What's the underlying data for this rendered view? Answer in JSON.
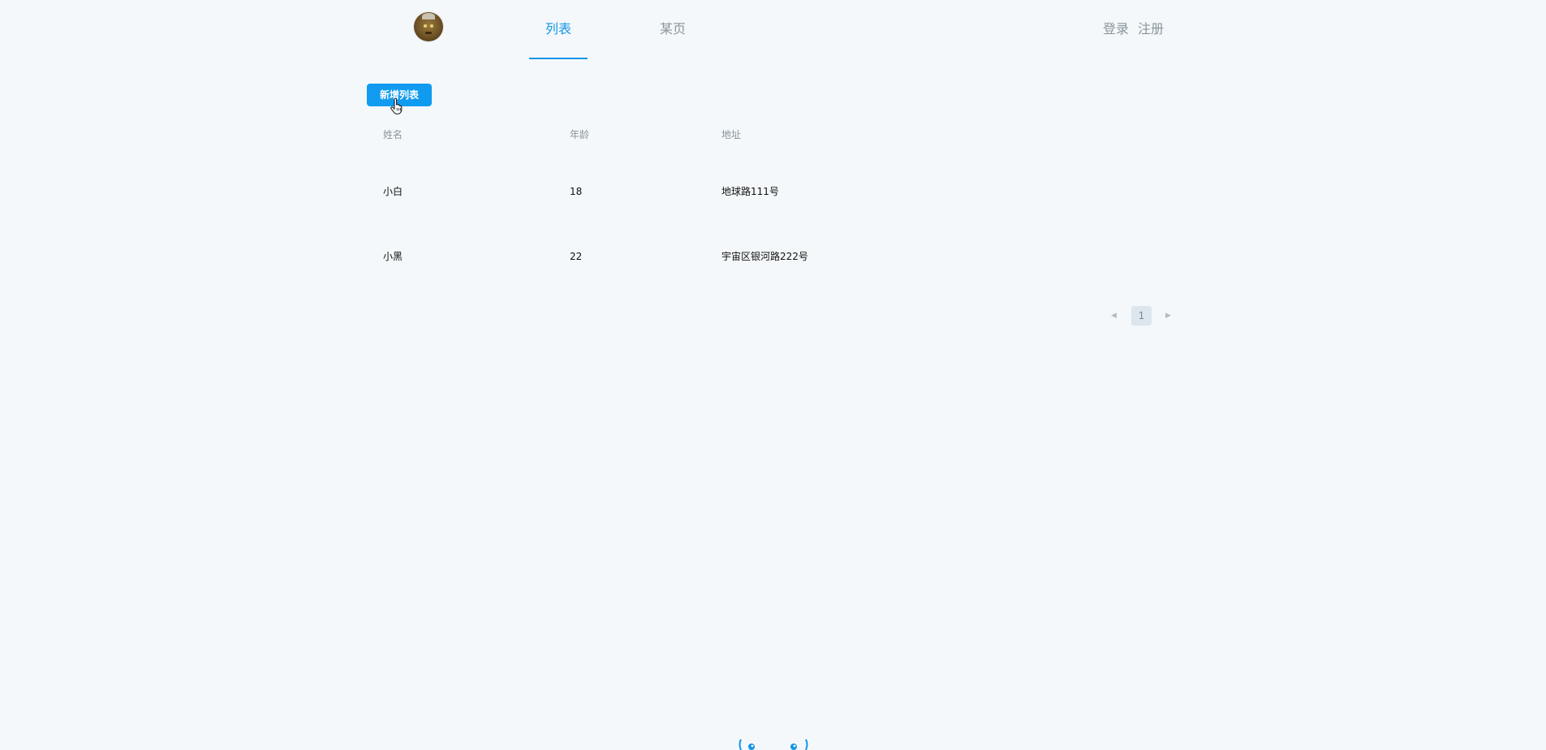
{
  "header": {
    "avatar_icon": "avatar-icon",
    "tabs": [
      {
        "label": "列表",
        "active": true
      },
      {
        "label": "某页",
        "active": false
      }
    ],
    "auth": {
      "login_label": "登录",
      "register_label": "注册"
    },
    "accent_color": "#1495e8"
  },
  "toolbar": {
    "add_label": "新增列表"
  },
  "table": {
    "columns": [
      "姓名",
      "年龄",
      "地址"
    ],
    "rows": [
      [
        "小白",
        "18",
        "地球路111号"
      ],
      [
        "小黑",
        "22",
        "宇宙区银河路222号"
      ]
    ]
  },
  "pagination": {
    "current_page": "1",
    "prev_icon": "chevron-left-icon",
    "next_icon": "chevron-right-icon"
  },
  "footer": {
    "mascot_icon": "mascot-eyes-icon"
  }
}
